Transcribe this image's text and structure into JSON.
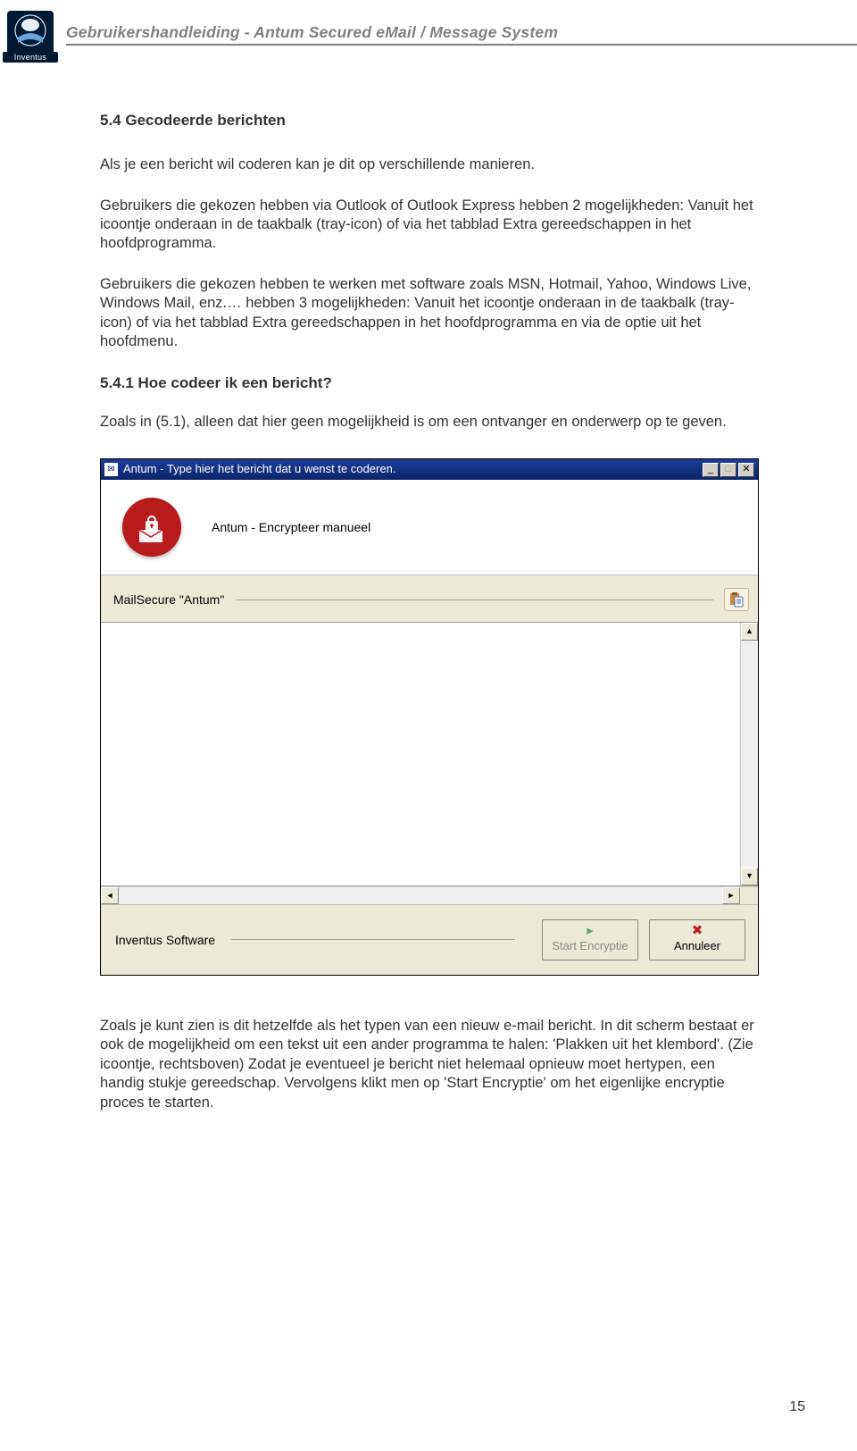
{
  "header": {
    "logo_caption": "Inventus",
    "doc_title": "Gebruikershandleiding - Antum Secured eMail / Message System"
  },
  "section": {
    "heading": "5.4 Gecodeerde berichten",
    "p1": "Als je een bericht wil coderen kan je dit op verschillende manieren.",
    "p2": "Gebruikers die gekozen hebben via Outlook of Outlook Express hebben 2 mogelijkheden: Vanuit het icoontje onderaan in de taakbalk (tray-icon) of via het tabblad Extra gereedschappen in het hoofdprogramma.",
    "p3": "Gebruikers die gekozen hebben te werken met software zoals MSN, Hotmail, Yahoo, Windows Live, Windows Mail, enz.… hebben 3 mogelijkheden: Vanuit het icoontje onderaan in de taakbalk (tray-icon) of via het tabblad Extra gereedschappen in het hoofdprogramma en via de optie uit het hoofdmenu.",
    "subheading": "5.4.1 Hoe codeer ik een bericht?",
    "p4": "Zoals in (5.1), alleen dat hier geen mogelijkheid is om een ontvanger en onderwerp op te geven.",
    "p5": "Zoals je kunt zien is dit hetzelfde als het typen van een nieuw e-mail bericht. In dit scherm bestaat er ook de mogelijkheid om een tekst uit een ander programma te halen: 'Plakken uit het klembord'. (Zie icoontje, rechtsboven) Zodat je eventueel je bericht niet helemaal opnieuw moet hertypen, een handig stukje gereedschap. Vervolgens klikt men op 'Start Encryptie' om het eigenlijke encryptie proces te starten."
  },
  "dialog": {
    "title": "Antum - Type hier het bericht dat u wenst te coderen.",
    "banner_text": "Antum - Encrypteer manueel",
    "field_label": "MailSecure \"Antum\"",
    "footer_vendor": "Inventus Software",
    "btn_start": "Start Encryptie",
    "btn_cancel": "Annuleer"
  },
  "page_number": "15"
}
